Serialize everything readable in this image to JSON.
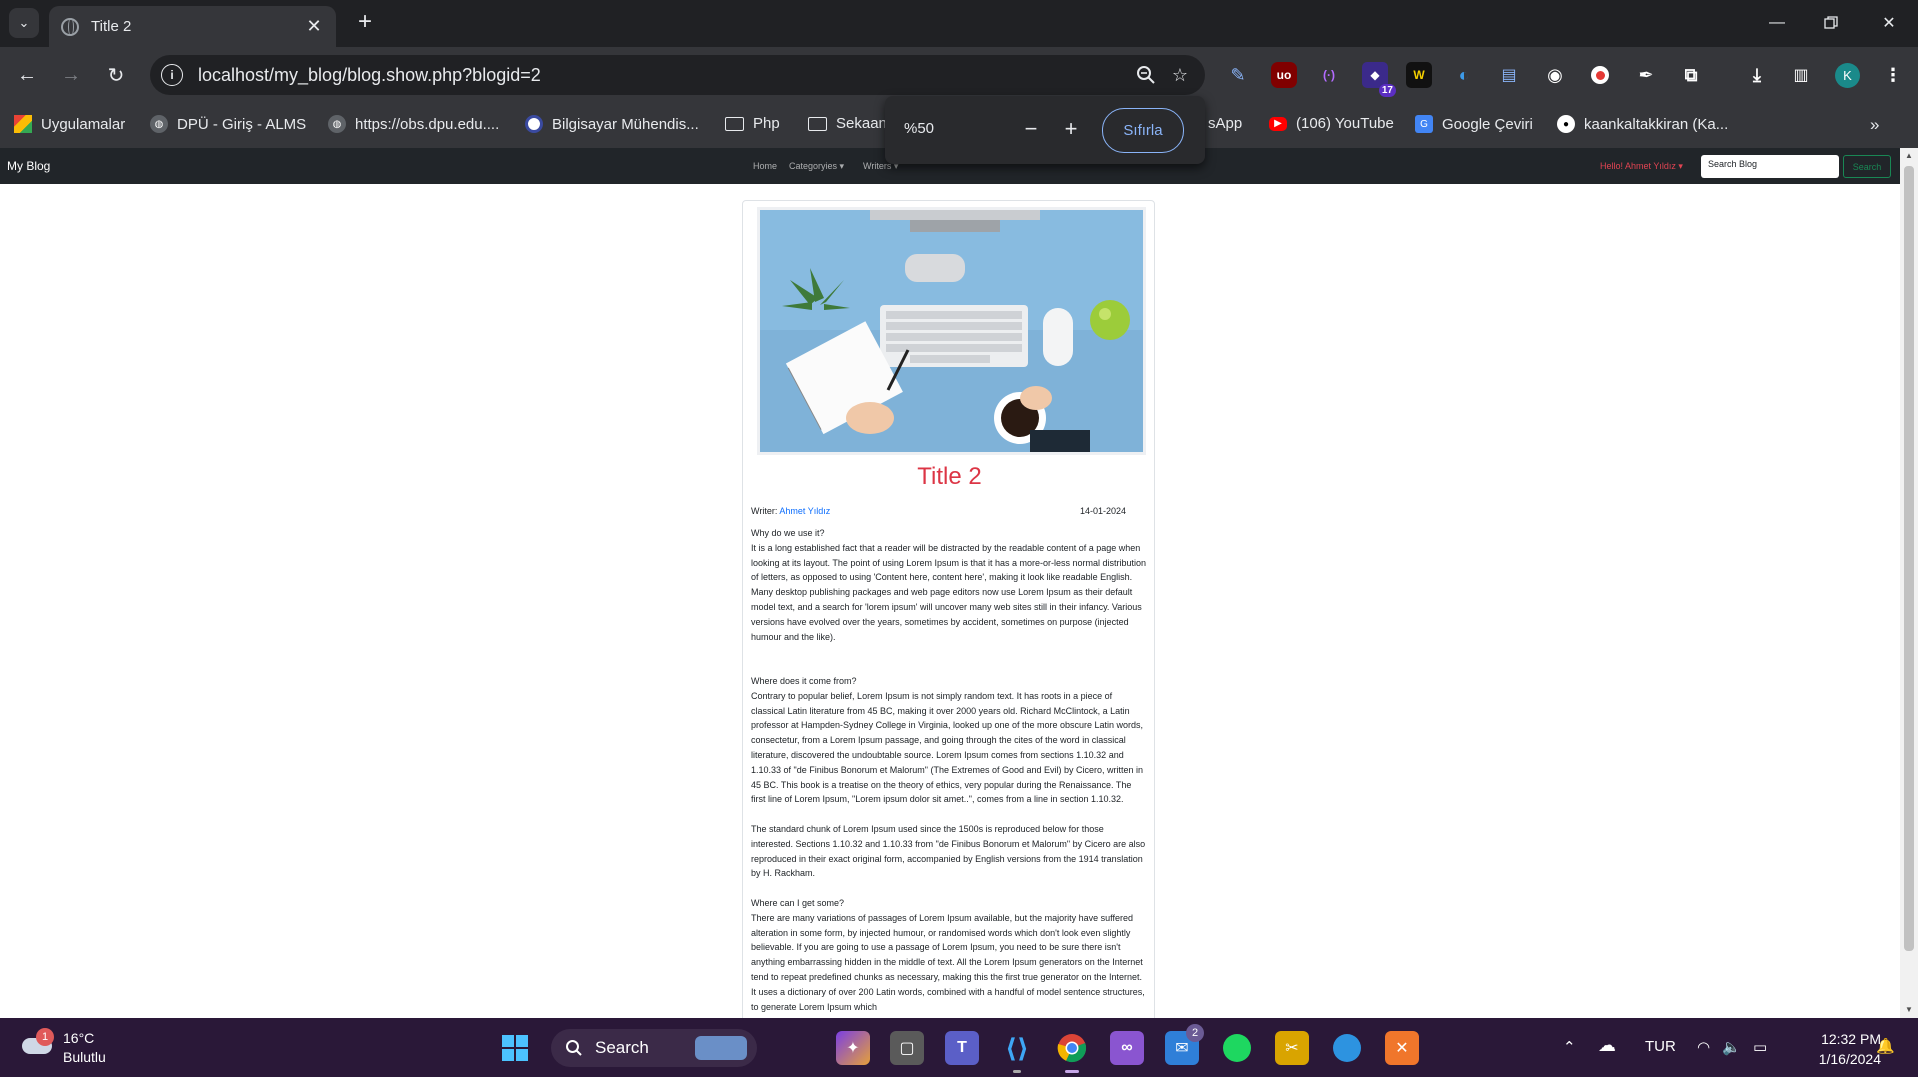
{
  "tab": {
    "title": "Title 2"
  },
  "address": {
    "url": "localhost/my_blog/blog.show.php?blogid=2"
  },
  "extensions": {
    "badge": "17",
    "profile_initial": "K"
  },
  "bookmarks": [
    "Uygulamalar",
    "DPÜ - Giriş - ALMS",
    "https://obs.dpu.edu....",
    "Bilgisayar Mühendis...",
    "Php",
    "Sekaan",
    "sApp",
    "(106) YouTube",
    "Google Çeviri",
    "kaankaltakkiran (Ka..."
  ],
  "zoom": {
    "level": "%50",
    "reset_label": "Sıfırla"
  },
  "site": {
    "brand": "My Blog",
    "nav": [
      "Home",
      "Categoryies",
      "Writers"
    ],
    "greeting": "Hello! Ahmet Yıldız",
    "search_placeholder": "Search Blog",
    "search_button": "Search"
  },
  "post": {
    "title": "Title 2",
    "writer_label": "Writer:",
    "writer_name": "Ahmet Yıldız",
    "date": "14-01-2024",
    "body": "Why do we use it?\nIt is a long established fact that a reader will be distracted by the readable content of a page when looking at its layout. The point of using Lorem Ipsum is that it has a more-or-less normal distribution of letters, as opposed to using 'Content here, content here', making it look like readable English. Many desktop publishing packages and web page editors now use Lorem Ipsum as their default model text, and a search for 'lorem ipsum' will uncover many web sites still in their infancy. Various versions have evolved over the years, sometimes by accident, sometimes on purpose (injected humour and the like).\n\n\nWhere does it come from?\nContrary to popular belief, Lorem Ipsum is not simply random text. It has roots in a piece of classical Latin literature from 45 BC, making it over 2000 years old. Richard McClintock, a Latin professor at Hampden-Sydney College in Virginia, looked up one of the more obscure Latin words, consectetur, from a Lorem Ipsum passage, and going through the cites of the word in classical literature, discovered the undoubtable source. Lorem Ipsum comes from sections 1.10.32 and 1.10.33 of \"de Finibus Bonorum et Malorum\" (The Extremes of Good and Evil) by Cicero, written in 45 BC. This book is a treatise on the theory of ethics, very popular during the Renaissance. The first line of Lorem Ipsum, \"Lorem ipsum dolor sit amet..\", comes from a line in section 1.10.32.\n\nThe standard chunk of Lorem Ipsum used since the 1500s is reproduced below for those interested. Sections 1.10.32 and 1.10.33 from \"de Finibus Bonorum et Malorum\" by Cicero are also reproduced in their exact original form, accompanied by English versions from the 1914 translation by H. Rackham.\n\nWhere can I get some?\nThere are many variations of passages of Lorem Ipsum available, but the majority have suffered alteration in some form, by injected humour, or randomised words which don't look even slightly believable. If you are going to use a passage of Lorem Ipsum, you need to be sure there isn't anything embarrassing hidden in the middle of text. All the Lorem Ipsum generators on the Internet tend to repeat predefined chunks as necessary, making this the first true generator on the Internet. It uses a dictionary of over 200 Latin words, combined with a handful of model sentence structures, to generate Lorem Ipsum which"
  },
  "taskbar": {
    "weather_temp": "16°C",
    "weather_desc": "Bulutlu",
    "weather_badge": "1",
    "search_label": "Search",
    "mail_badge": "2",
    "language": "TUR",
    "time": "12:32 PM",
    "date": "1/16/2024"
  }
}
